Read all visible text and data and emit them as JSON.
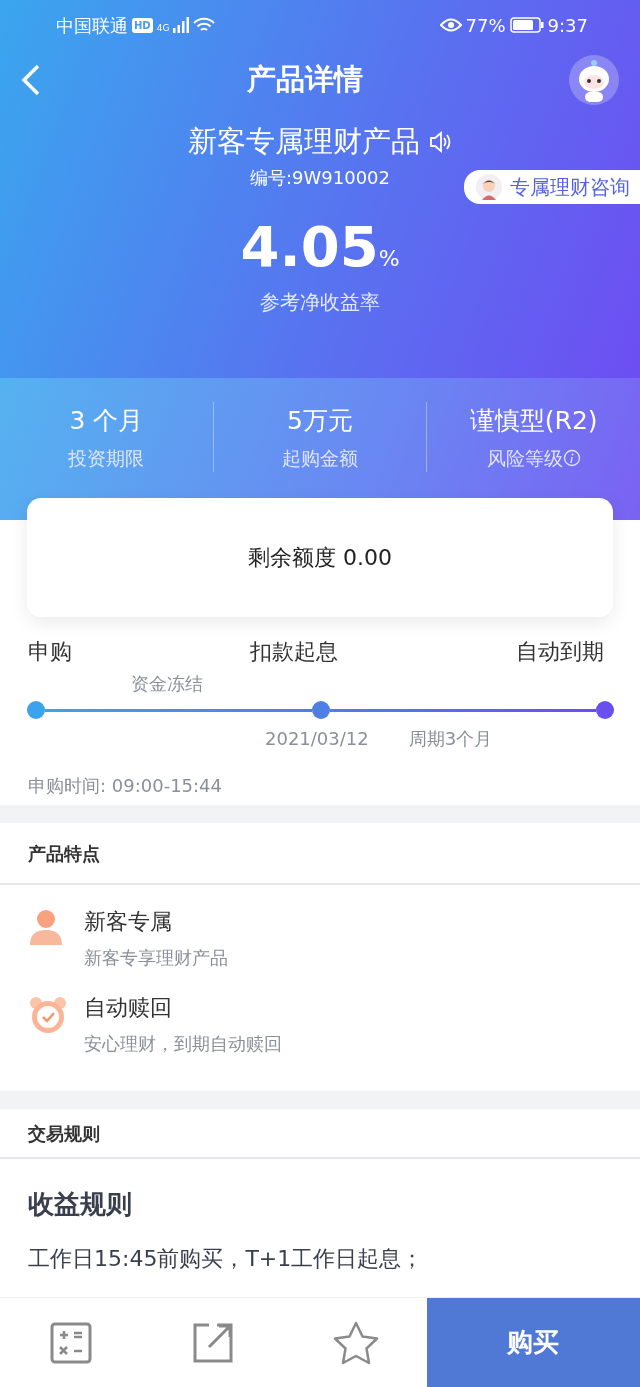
{
  "status_bar": {
    "carrier": "中国联通",
    "hd": "HD",
    "network": "4G",
    "battery": "77%",
    "time": "9:37"
  },
  "header": {
    "title": "产品详情"
  },
  "product": {
    "name": "新客专属理财产品",
    "code": "编号:9W910002",
    "consult": "专属理财咨询",
    "rate": "4.05",
    "rate_unit": "%",
    "rate_label": "参考净收益率"
  },
  "stats": [
    {
      "value": "3 个月",
      "label": "投资期限",
      "info": false
    },
    {
      "value": "5万元",
      "label": "起购金额",
      "info": false
    },
    {
      "value": "谨慎型(R2)",
      "label": "风险等级",
      "info": true
    }
  ],
  "quota": "剩余额度 0.00",
  "timeline": {
    "steps": [
      "申购",
      "扣款起息",
      "自动到期"
    ],
    "phase_label": "资金冻结",
    "date": "2021/03/12",
    "period": "周期3个月",
    "hours": "申购时间: 09:00-15:44"
  },
  "features": {
    "title": "产品特点",
    "items": [
      {
        "kind": "person",
        "title": "新客专属",
        "subtitle": "新客专享理财产品"
      },
      {
        "kind": "clock",
        "title": "自动赎回",
        "subtitle": "安心理财，到期自动赎回"
      }
    ]
  },
  "rules": {
    "title": "交易规则",
    "heading": "收益规则",
    "lines": [
      "工作日15:45前购买，T+1工作日起息；"
    ]
  },
  "bottom_bar": {
    "buy": "购买"
  }
}
